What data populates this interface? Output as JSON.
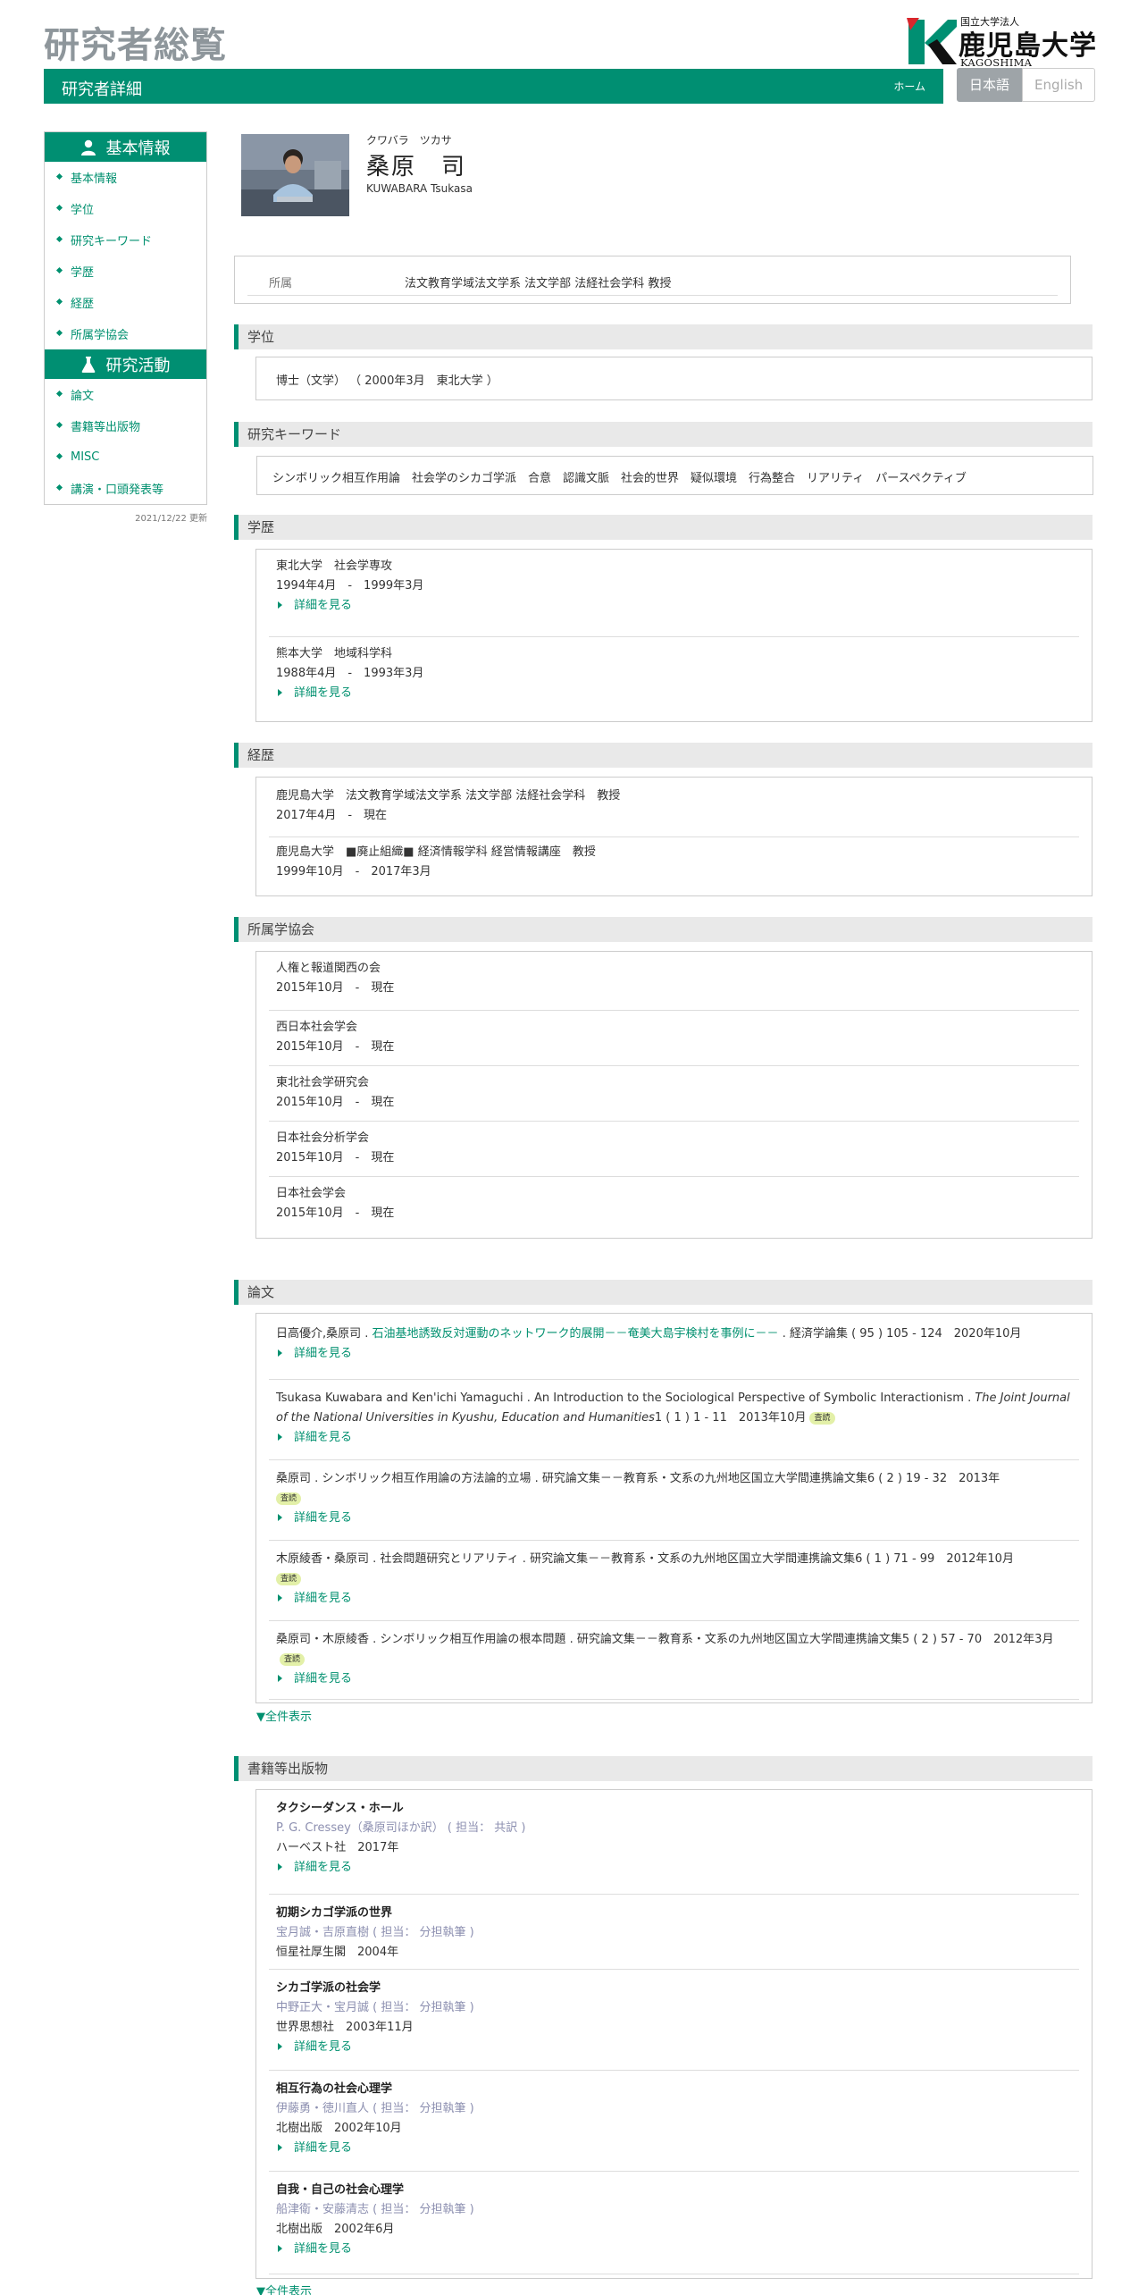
{
  "header": {
    "site_title": "研究者総覧",
    "page_title": "研究者詳細",
    "home": "ホーム",
    "lang_ja": "日本語",
    "lang_en": "English",
    "logo": {
      "small": "国立大学法人",
      "big": "鹿児島大学",
      "en": "KAGOSHIMA UNIVERSITY"
    },
    "colors": {
      "brand": "#008f72",
      "link": "#00906f"
    }
  },
  "sidebar": {
    "basic_head": "基本情報",
    "basic_items": [
      "基本情報",
      "学位",
      "研究キーワード",
      "学歴",
      "経歴",
      "所属学協会"
    ],
    "activity_head": "研究活動",
    "activity_items": [
      "論文",
      "書籍等出版物",
      "MISC",
      "講演・口頭発表等"
    ],
    "updated": "2021/12/22 更新"
  },
  "profile": {
    "kana": "クワバラ　ツカサ",
    "name": "桑原　司",
    "roman": "KUWABARA Tsukasa"
  },
  "affiliation": {
    "label": "所属",
    "value": "法文教育学域法文学系 法文学部 法経社会学科 教授"
  },
  "degree": {
    "head": "学位",
    "value": "博士（文学） （ 2000年3月　東北大学 ）"
  },
  "keywords": {
    "head": "研究キーワード",
    "value": "シンボリック相互作用論　社会学のシカゴ学派　合意　認識文脈　社会的世界　疑似環境　行為整合　リアリティ　パースペクティブ"
  },
  "more_label": "詳細を見る",
  "show_all": "▼全件表示",
  "education": {
    "head": "学歴",
    "items": [
      {
        "school": "東北大学　社会学専攻",
        "period": "1994年4月　-　1999年3月"
      },
      {
        "school": "熊本大学　地域科学科",
        "period": "1988年4月　-　1993年3月"
      }
    ]
  },
  "career": {
    "head": "経歴",
    "items": [
      {
        "org": "鹿児島大学　法文教育学域法文学系 法文学部 法経社会学科　教授",
        "period": "2017年4月　-　現在"
      },
      {
        "org": "鹿児島大学　■廃止組織■ 経済情報学科 経営情報講座　教授",
        "period": "1999年10月　-　2017年3月"
      }
    ]
  },
  "societies": {
    "head": "所属学協会",
    "items": [
      {
        "name": "人権と報道関西の会",
        "period": "2015年10月　-　現在"
      },
      {
        "name": "西日本社会学会",
        "period": "2015年10月　-　現在"
      },
      {
        "name": "東北社会学研究会",
        "period": "2015年10月　-　現在"
      },
      {
        "name": "日本社会分析学会",
        "period": "2015年10月　-　現在"
      },
      {
        "name": "日本社会学会",
        "period": "2015年10月　-　現在"
      }
    ]
  },
  "papers": {
    "head": "論文",
    "badge": "査読",
    "items": [
      {
        "authors": "日高優介,桑原司",
        "title": "石油基地誘致反対運動のネットワーク的展開－－奄美大島宇検村を事例に－－",
        "rest": "経済学論集 ( 95 ) 105 - 124　2020年10月"
      },
      {
        "authors": "Tsukasa Kuwabara and Ken'ichi Yamaguchi",
        "title": "An Introduction to the Sociological Perspective of Symbolic Interactionism",
        "journal": "The Joint Journal of the National Universities in Kyushu, Education and Humanities",
        "rest": "1 ( 1 ) 1 - 11　2013年10月"
      },
      {
        "authors": "桑原司",
        "title": "シンボリック相互作用論の方法論的立場",
        "rest": "研究論文集－－教育系・文系の九州地区国立大学間連携論文集6 ( 2 ) 19 - 32　2013年"
      },
      {
        "authors": "木原綾香・桑原司",
        "title": "社会問題研究とリアリティ",
        "rest": "研究論文集－－教育系・文系の九州地区国立大学間連携論文集6 ( 1 ) 71 - 99　2012年10月"
      },
      {
        "authors": "桑原司・木原綾香",
        "title": "シンボリック相互作用論の根本問題",
        "rest": "研究論文集－－教育系・文系の九州地区国立大学間連携論文集5 ( 2 ) 57 - 70　2012年3月"
      }
    ]
  },
  "books": {
    "head": "書籍等出版物",
    "items": [
      {
        "title": "タクシーダンス・ホール",
        "authors": "P. G. Cressey（桑原司ほか訳） ( 担当： 共訳 )",
        "pub": "ハーベスト社　2017年"
      },
      {
        "title": "初期シカゴ学派の世界",
        "authors": "宝月誠・吉原直樹 ( 担当： 分担執筆 )",
        "pub": "恒星社厚生閣　2004年"
      },
      {
        "title": "シカゴ学派の社会学",
        "authors": "中野正大・宝月誠 ( 担当： 分担執筆 )",
        "pub": "世界思想社　2003年11月"
      },
      {
        "title": "相互行為の社会心理学",
        "authors": "伊藤勇・徳川直人 ( 担当： 分担執筆 )",
        "pub": "北樹出版　2002年10月"
      },
      {
        "title": "自我・自己の社会心理学",
        "authors": "船津衛・安藤清志 ( 担当： 分担執筆 )",
        "pub": "北樹出版　2002年6月"
      }
    ]
  }
}
